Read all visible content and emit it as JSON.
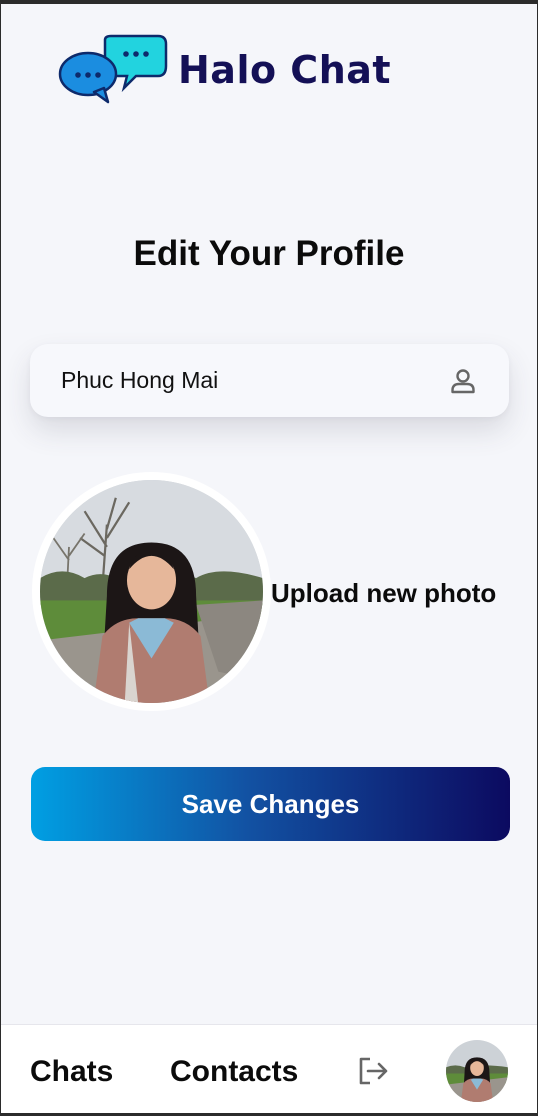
{
  "app": {
    "name": "Halo Chat",
    "logo_icon": "chat-bubbles-logo-icon"
  },
  "page": {
    "title": "Edit Your Profile"
  },
  "form": {
    "name_value": "Phuc Hong Mai",
    "name_icon": "user-icon",
    "upload_label": "Upload new photo",
    "save_label": "Save Changes"
  },
  "nav": {
    "chats_label": "Chats",
    "contacts_label": "Contacts",
    "logout_icon": "logout-icon"
  },
  "colors": {
    "brand_text": "#141056",
    "gradient_start": "#009fe3",
    "gradient_end": "#0c0a60",
    "logo_blue": "#1b8de0",
    "logo_cyan": "#22d3df"
  }
}
